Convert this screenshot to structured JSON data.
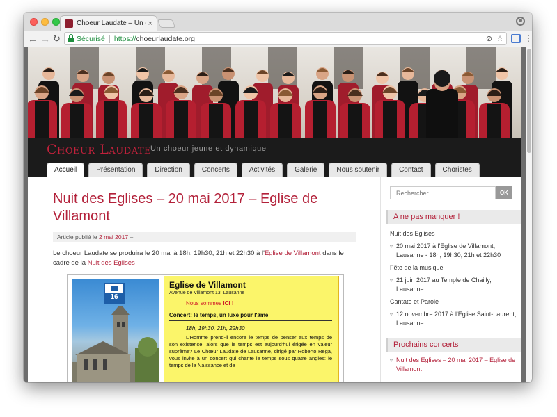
{
  "browser": {
    "tab_title": "Choeur Laudate – Un choeur je...",
    "tab_close": "×",
    "secure_label": "Sécurisé",
    "url_scheme": "https://",
    "url_host": "choeurlaudate.org",
    "back": "←",
    "forward": "→",
    "reload": "↻",
    "star": "☆",
    "menu": "⋮"
  },
  "site": {
    "title": "Choeur Laudate",
    "tagline": "Un choeur jeune et dynamique",
    "accent": "#b3213a",
    "menu": [
      {
        "label": "Accueil",
        "active": true
      },
      {
        "label": "Présentation"
      },
      {
        "label": "Direction"
      },
      {
        "label": "Concerts"
      },
      {
        "label": "Activités"
      },
      {
        "label": "Galerie"
      },
      {
        "label": "Nous soutenir"
      },
      {
        "label": "Contact"
      },
      {
        "label": "Choristes"
      }
    ]
  },
  "post": {
    "title": "Nuit des Eglises – 20 mai 2017 – Eglise de Villamont",
    "meta_prefix": "Article publié le",
    "meta_date": "2 mai 2017",
    "meta_suffix": "–",
    "body_1": "Le choeur Laudate se produira le 20 mai à 18h, 19h30, 21h et 22h30 à l'",
    "body_link_1": "Eglise de Villamont",
    "body_2": " dans le cadre de la ",
    "body_link_2": "Nuit des Eglises"
  },
  "poster": {
    "badge_number": "16",
    "title": "Eglise de Villamont",
    "address": "Avenue de Villamont 13, Lausanne",
    "here_prefix": "Nous sommes ",
    "here_bold": "ICI",
    "here_suffix": " !",
    "concert": "Concert: le temps, un luxe pour l'âme",
    "times": "18h, 19h30, 21h, 22h30",
    "text": "L'Homme prend-il encore le temps de penser aux temps de son existence, alors que le temps est aujourd'hui érigée en valeur suprême? Le Chœur Laudate de Lausanne, dirigé par Roberto Rega, vous invite à un concert qui chante le temps sous quatre angles: le temps de la Naissance et de"
  },
  "sidebar": {
    "search_placeholder": "Rechercher",
    "search_button": "OK",
    "widget1_title": "A ne pas manquer !",
    "groups": [
      {
        "name": "Nuit des Eglises",
        "event": "20 mai 2017 à l'Eglise de Villamont, Lausanne - 18h, 19h30, 21h et 22h30"
      },
      {
        "name": "Fête de la musique",
        "event": "21 juin 2017 au Temple de Chailly, Lausanne"
      },
      {
        "name": "Cantate et Parole",
        "event": "12 novembre 2017 à l'Eglise Saint-Laurent, Lausanne"
      }
    ],
    "widget2_title": "Prochains concerts",
    "concerts": [
      {
        "label": "Nuit des Eglises – 20 mai 2017 – Eglise de Villamont"
      }
    ],
    "bullet": "▿"
  }
}
